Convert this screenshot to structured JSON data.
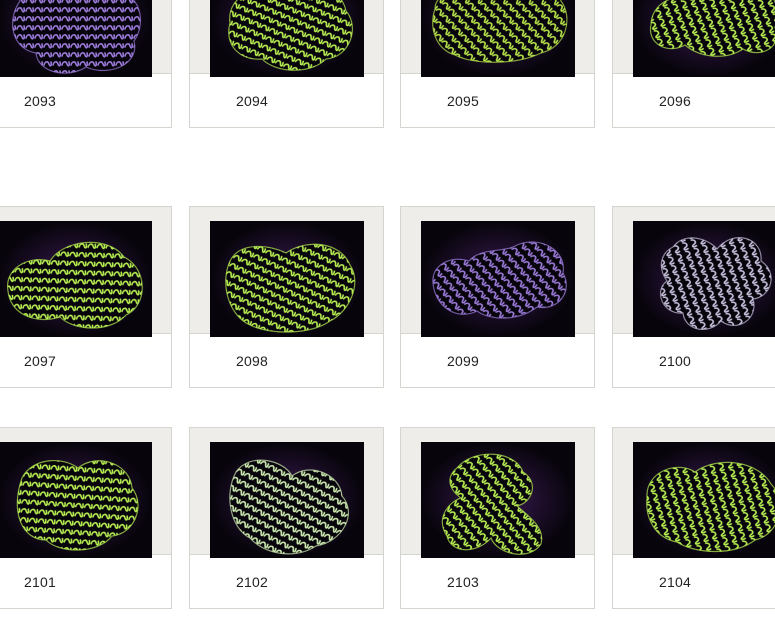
{
  "gallery": {
    "items": [
      {
        "label": "2093",
        "tone": "violet"
      },
      {
        "label": "2094",
        "tone": "lime"
      },
      {
        "label": "2095",
        "tone": "violet-lime"
      },
      {
        "label": "2096",
        "tone": "lime"
      },
      {
        "label": "2097",
        "tone": "lime"
      },
      {
        "label": "2098",
        "tone": "lime"
      },
      {
        "label": "2099",
        "tone": "violet"
      },
      {
        "label": "2100",
        "tone": "lavender"
      },
      {
        "label": "2101",
        "tone": "lime"
      },
      {
        "label": "2102",
        "tone": "mint"
      },
      {
        "label": "2103",
        "tone": "lime"
      },
      {
        "label": "2104",
        "tone": "lime"
      }
    ]
  },
  "colors": {
    "violet": "#9a7ad8",
    "lime": "#b8ee52",
    "violet-lime": "#b6e24a",
    "lavender": "#c6c0dc",
    "mint": "#cdeab0",
    "background": "#07040b",
    "mat": "#efede9"
  }
}
